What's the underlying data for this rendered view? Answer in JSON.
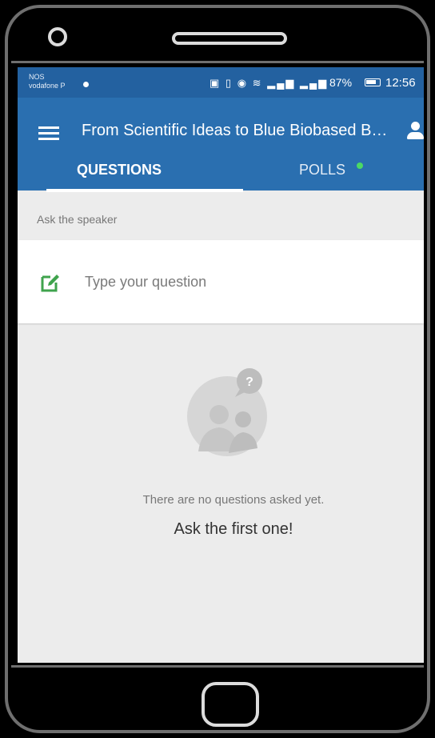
{
  "statusbar": {
    "carrier_line1": "NOS",
    "carrier_line2": "vodafone P",
    "battery_percent": "87%",
    "time": "12:56"
  },
  "appbar": {
    "title": "From Scientific Ideas to Blue Biobased Bu...",
    "tabs": [
      {
        "label": "QUESTIONS",
        "active": true
      },
      {
        "label": "POLLS",
        "active": false,
        "has_new": true
      }
    ]
  },
  "ask": {
    "label": "Ask the speaker",
    "placeholder": "Type your question"
  },
  "empty_state": {
    "message": "There are no questions asked yet.",
    "call_to_action": "Ask the first one!"
  },
  "icons": {
    "menu": "hamburger-icon",
    "account": "user-icon",
    "compose": "edit-icon",
    "empty": "people-question-icon"
  },
  "colors": {
    "statusbar": "#2361a0",
    "appbar": "#2a6fb0",
    "accent_green": "#4cd964",
    "background": "#ececec"
  }
}
